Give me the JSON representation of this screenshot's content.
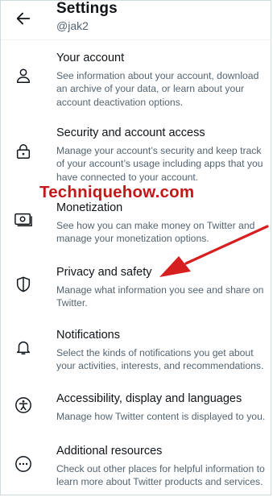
{
  "header": {
    "title": "Settings",
    "handle": "@jak2",
    "back_icon": "arrow-left-icon"
  },
  "items": [
    {
      "icon": "person-icon",
      "label": "Your account",
      "desc": "See information about your account, download an archive of your data, or learn about your account deactivation options."
    },
    {
      "icon": "lock-icon",
      "label": "Security and account access",
      "desc": "Manage your account’s security and keep track of your account’s usage including apps that you have connected to your account."
    },
    {
      "icon": "money-icon",
      "label": "Monetization",
      "desc": "See how you can make money on Twitter and manage your monetization options."
    },
    {
      "icon": "shield-icon",
      "label": "Privacy and safety",
      "desc": "Manage what information you see and share on Twitter."
    },
    {
      "icon": "bell-icon",
      "label": "Notifications",
      "desc": "Select the kinds of notifications you get about your activities, interests, and recommendations."
    },
    {
      "icon": "accessibility-icon",
      "label": "Accessibility, display and languages",
      "desc": "Manage how Twitter content is displayed to you."
    },
    {
      "icon": "more-icon",
      "label": "Additional resources",
      "desc": "Check out other places for helpful information to learn more about Twitter products and services."
    }
  ],
  "watermark": "Techniquehow.com",
  "colors": {
    "text": "#0f1419",
    "secondary_text": "#536471",
    "watermark": "#c21818",
    "arrow": "#d61f1f"
  }
}
